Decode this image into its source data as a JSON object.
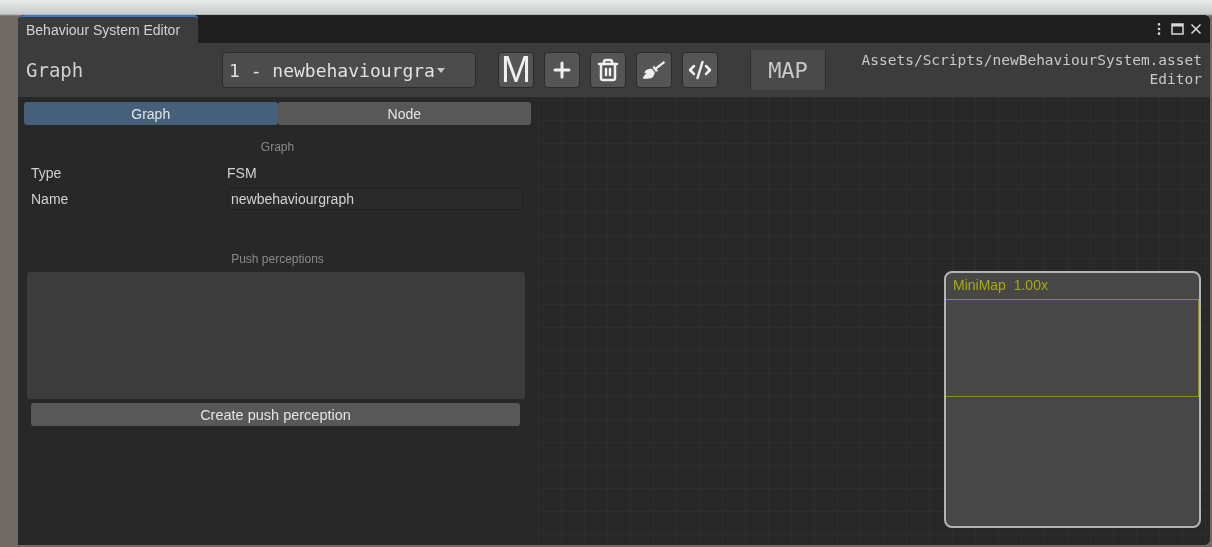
{
  "window": {
    "title": "Behaviour System Editor"
  },
  "toolbar": {
    "title": "Graph",
    "graph_selector": {
      "value": "1 - newbehaviourgra"
    },
    "buttons": [
      {
        "kind": "text",
        "label": "M"
      },
      {
        "kind": "add"
      },
      {
        "kind": "delete"
      },
      {
        "kind": "clean"
      },
      {
        "kind": "code"
      }
    ],
    "map_button": {
      "label": "MAP"
    },
    "asset_path": "Assets/Scripts/newBehaviourSystem.asset",
    "asset_mode": "Editor"
  },
  "tabs": [
    {
      "label": "Graph",
      "selected": true
    },
    {
      "label": "Node",
      "selected": false
    }
  ],
  "inspector": {
    "section_title": "Graph",
    "fields": [
      {
        "kind": "text",
        "label": "Type",
        "value": "FSM"
      },
      {
        "kind": "input",
        "label": "Name",
        "value": "newbehaviourgraph"
      }
    ],
    "list_title": "Push perceptions",
    "list_button": "Create push perception"
  },
  "minimap": {
    "title": "MiniMap",
    "zoom": "1.00x"
  }
}
